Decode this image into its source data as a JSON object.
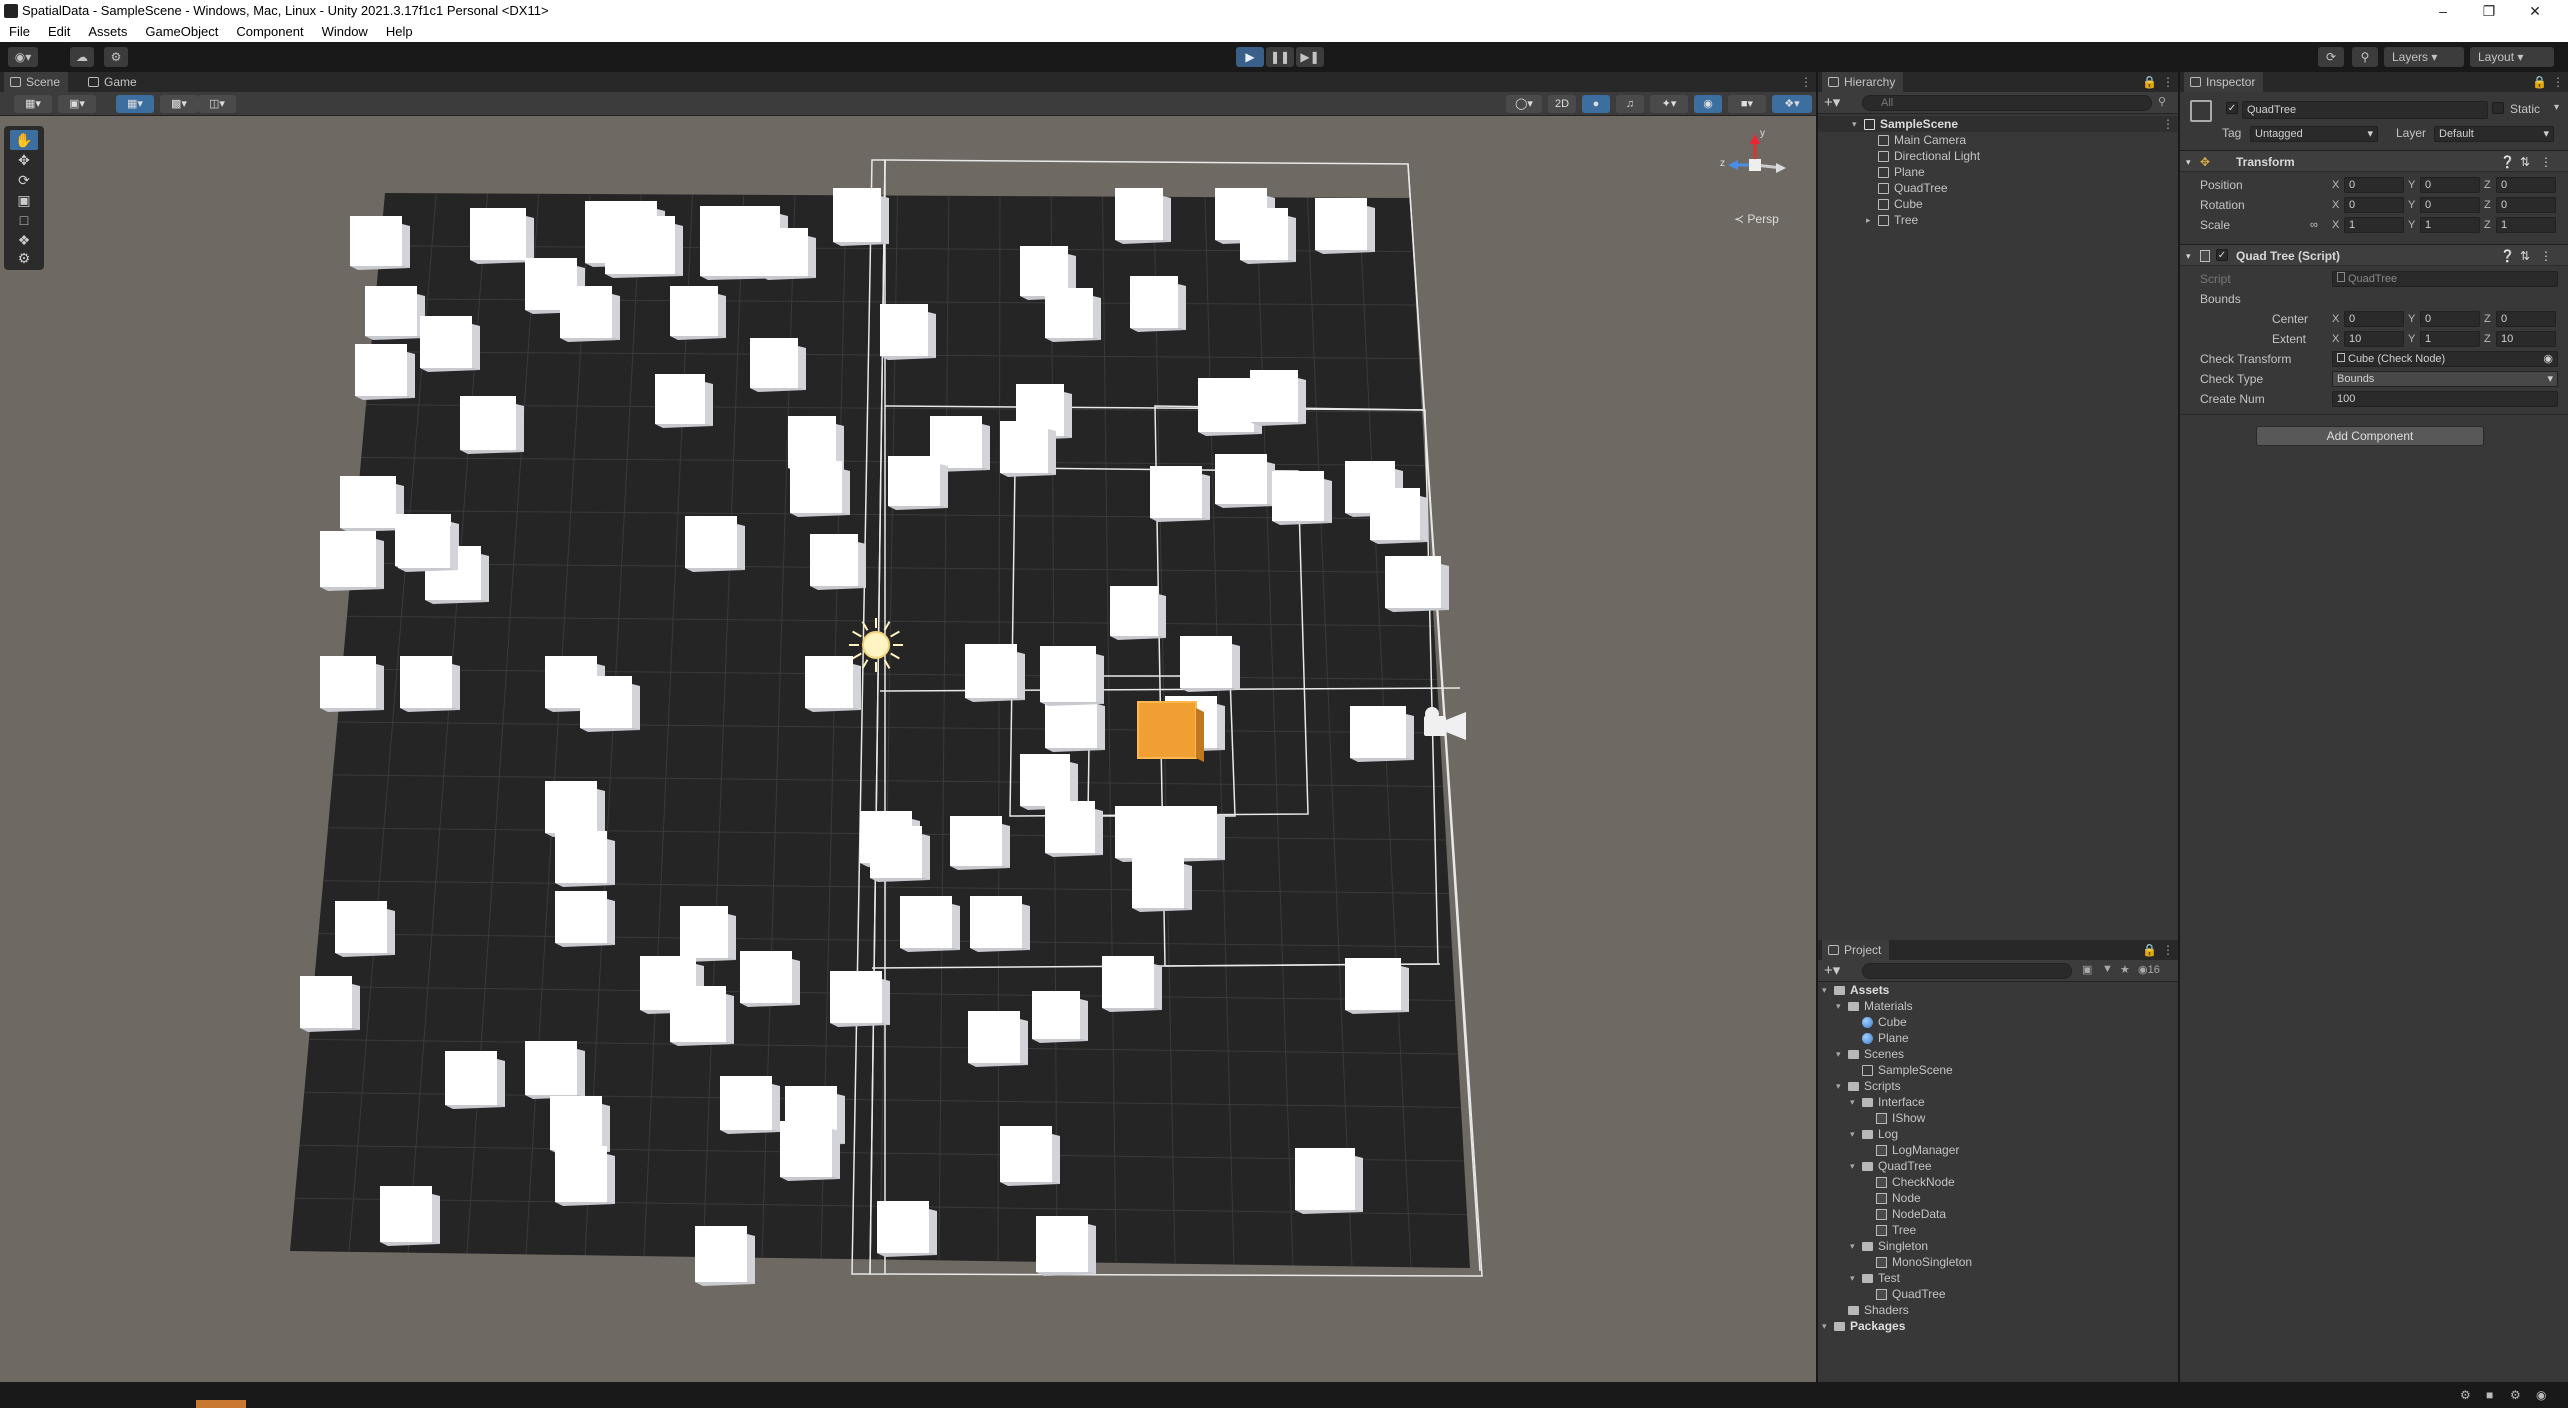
{
  "window": {
    "title": "SpatialData - SampleScene - Windows, Mac, Linux - Unity 2021.3.17f1c1 Personal <DX11>"
  },
  "menu": [
    "File",
    "Edit",
    "Assets",
    "GameObject",
    "Component",
    "Window",
    "Help"
  ],
  "toolbar": {
    "layers_label": "Layers",
    "layout_label": "Layout"
  },
  "scene_view": {
    "tabs": [
      "Scene",
      "Game"
    ],
    "mode_2d": "2D",
    "persp_label": "Persp",
    "gizmo_axes": {
      "y": "y",
      "z": "z"
    }
  },
  "hierarchy": {
    "tab": "Hierarchy",
    "search_placeholder": "All",
    "scene": "SampleScene",
    "items": [
      "Main Camera",
      "Directional Light",
      "Plane",
      "QuadTree",
      "Cube",
      "Tree"
    ]
  },
  "project": {
    "tab": "Project",
    "badge": "16",
    "tree": [
      {
        "label": "Assets",
        "depth": 0,
        "type": "folder",
        "bold": true
      },
      {
        "label": "Materials",
        "depth": 1,
        "type": "folder"
      },
      {
        "label": "Cube",
        "depth": 2,
        "type": "material"
      },
      {
        "label": "Plane",
        "depth": 2,
        "type": "material"
      },
      {
        "label": "Scenes",
        "depth": 1,
        "type": "folder"
      },
      {
        "label": "SampleScene",
        "depth": 2,
        "type": "scene"
      },
      {
        "label": "Scripts",
        "depth": 1,
        "type": "folder"
      },
      {
        "label": "Interface",
        "depth": 2,
        "type": "folder"
      },
      {
        "label": "IShow",
        "depth": 3,
        "type": "script"
      },
      {
        "label": "Log",
        "depth": 2,
        "type": "folder"
      },
      {
        "label": "LogManager",
        "depth": 3,
        "type": "script"
      },
      {
        "label": "QuadTree",
        "depth": 2,
        "type": "folder"
      },
      {
        "label": "CheckNode",
        "depth": 3,
        "type": "script"
      },
      {
        "label": "Node",
        "depth": 3,
        "type": "script"
      },
      {
        "label": "NodeData",
        "depth": 3,
        "type": "script"
      },
      {
        "label": "Tree",
        "depth": 3,
        "type": "script"
      },
      {
        "label": "Singleton",
        "depth": 2,
        "type": "folder"
      },
      {
        "label": "MonoSingleton",
        "depth": 3,
        "type": "script"
      },
      {
        "label": "Test",
        "depth": 2,
        "type": "folder"
      },
      {
        "label": "QuadTree",
        "depth": 3,
        "type": "script"
      },
      {
        "label": "Shaders",
        "depth": 1,
        "type": "folder"
      },
      {
        "label": "Packages",
        "depth": 0,
        "type": "folder",
        "bold": true
      }
    ]
  },
  "inspector": {
    "tab": "Inspector",
    "object_name": "QuadTree",
    "static_label": "Static",
    "tag_label": "Tag",
    "tag_value": "Untagged",
    "layer_label": "Layer",
    "layer_value": "Default",
    "transform": {
      "title": "Transform",
      "position": {
        "label": "Position",
        "x": "0",
        "y": "0",
        "z": "0"
      },
      "rotation": {
        "label": "Rotation",
        "x": "0",
        "y": "0",
        "z": "0"
      },
      "scale": {
        "label": "Scale",
        "x": "1",
        "y": "1",
        "z": "1"
      }
    },
    "script_component": {
      "title": "Quad Tree (Script)",
      "script_label": "Script",
      "script_value": "QuadTree",
      "bounds_label": "Bounds",
      "center": {
        "label": "Center",
        "x": "0",
        "y": "0",
        "z": "0"
      },
      "extent": {
        "label": "Extent",
        "x": "10",
        "y": "1",
        "z": "10"
      },
      "check_transform_label": "Check Transform",
      "check_transform_value": "Cube (Check Node)",
      "check_type_label": "Check Type",
      "check_type_value": "Bounds",
      "create_num_label": "Create Num",
      "create_num_value": "100"
    },
    "add_component": "Add Component"
  },
  "axis_letters": {
    "x": "X",
    "y": "Y",
    "z": "Z"
  },
  "colors": {
    "accent": "#3d6ea0",
    "selected_cube": "#f0a032",
    "cube_top": "#ffffff",
    "cube_side": "#d2d4da",
    "plane": "#252525",
    "background": "#6f6963"
  }
}
